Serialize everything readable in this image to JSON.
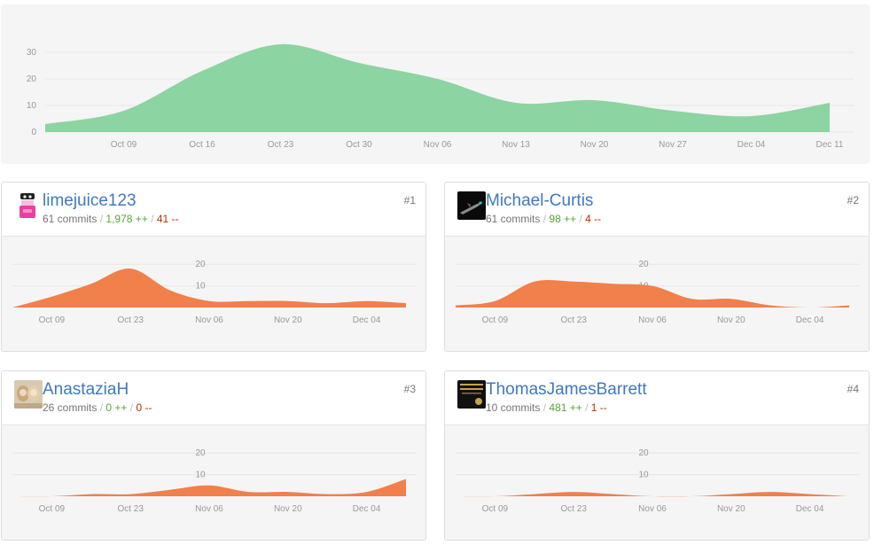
{
  "main_chart": {
    "x_ticks": [
      "Oct 09",
      "Oct 16",
      "Oct 23",
      "Oct 30",
      "Nov 06",
      "Nov 13",
      "Nov 20",
      "Nov 27",
      "Dec 04",
      "Dec 11"
    ],
    "y_ticks": [
      "0",
      "10",
      "20",
      "30"
    ],
    "fill_color": "#8cd4a2"
  },
  "contributors": [
    {
      "rank": "#1",
      "username": "limejuice123",
      "commits": "61 commits",
      "additions": "1,978 ++",
      "deletions": "41 --",
      "avatar": "pink-cartoon-avatar"
    },
    {
      "rank": "#2",
      "username": "Michael-Curtis",
      "commits": "61 commits",
      "additions": "98 ++",
      "deletions": "4 --",
      "avatar": "dark-airplane-avatar"
    },
    {
      "rank": "#3",
      "username": "AnastaziaH",
      "commits": "26 commits",
      "additions": "0 ++",
      "deletions": "0 --",
      "avatar": "photo-avatar"
    },
    {
      "rank": "#4",
      "username": "ThomasJamesBarrett",
      "commits": "10 commits",
      "additions": "481 ++",
      "deletions": "1 --",
      "avatar": "black-gold-logo-avatar"
    }
  ],
  "stats_separator": "/",
  "mini_x_ticks": [
    "Oct 09",
    "Oct 23",
    "Nov 06",
    "Nov 20",
    "Dec 04"
  ],
  "mini_y_ticks": [
    "10",
    "20"
  ],
  "mini_fill_color": "#f1804a",
  "chart_data": [
    {
      "type": "area",
      "x": [
        "Oct 02",
        "Oct 09",
        "Oct 16",
        "Oct 23",
        "Oct 30",
        "Nov 06",
        "Nov 13",
        "Nov 20",
        "Nov 27",
        "Dec 04",
        "Dec 11"
      ],
      "values": [
        3,
        8,
        23,
        33,
        26,
        20,
        11,
        12,
        8,
        6,
        11
      ],
      "ylim": [
        0,
        35
      ],
      "grid": true,
      "color": "#8cd4a2"
    },
    {
      "type": "area",
      "x": [
        "Oct 02",
        "Oct 09",
        "Oct 16",
        "Oct 23",
        "Oct 30",
        "Nov 06",
        "Nov 13",
        "Nov 20",
        "Nov 27",
        "Dec 04",
        "Dec 11"
      ],
      "series": [
        {
          "values": [
            0,
            5,
            11,
            18,
            8,
            3,
            3,
            3,
            2,
            3,
            2
          ]
        },
        {
          "values": [
            1,
            3,
            12,
            12,
            11,
            10,
            4,
            4,
            1,
            0,
            1
          ]
        },
        {
          "values": [
            0,
            0,
            1,
            1,
            3,
            5,
            2,
            2,
            1,
            2,
            8
          ]
        },
        {
          "values": [
            0,
            0,
            1,
            2,
            1,
            0,
            0,
            1,
            2,
            1,
            0
          ]
        }
      ],
      "ylim": [
        0,
        25
      ],
      "grid": true,
      "color": "#f1804a"
    }
  ]
}
